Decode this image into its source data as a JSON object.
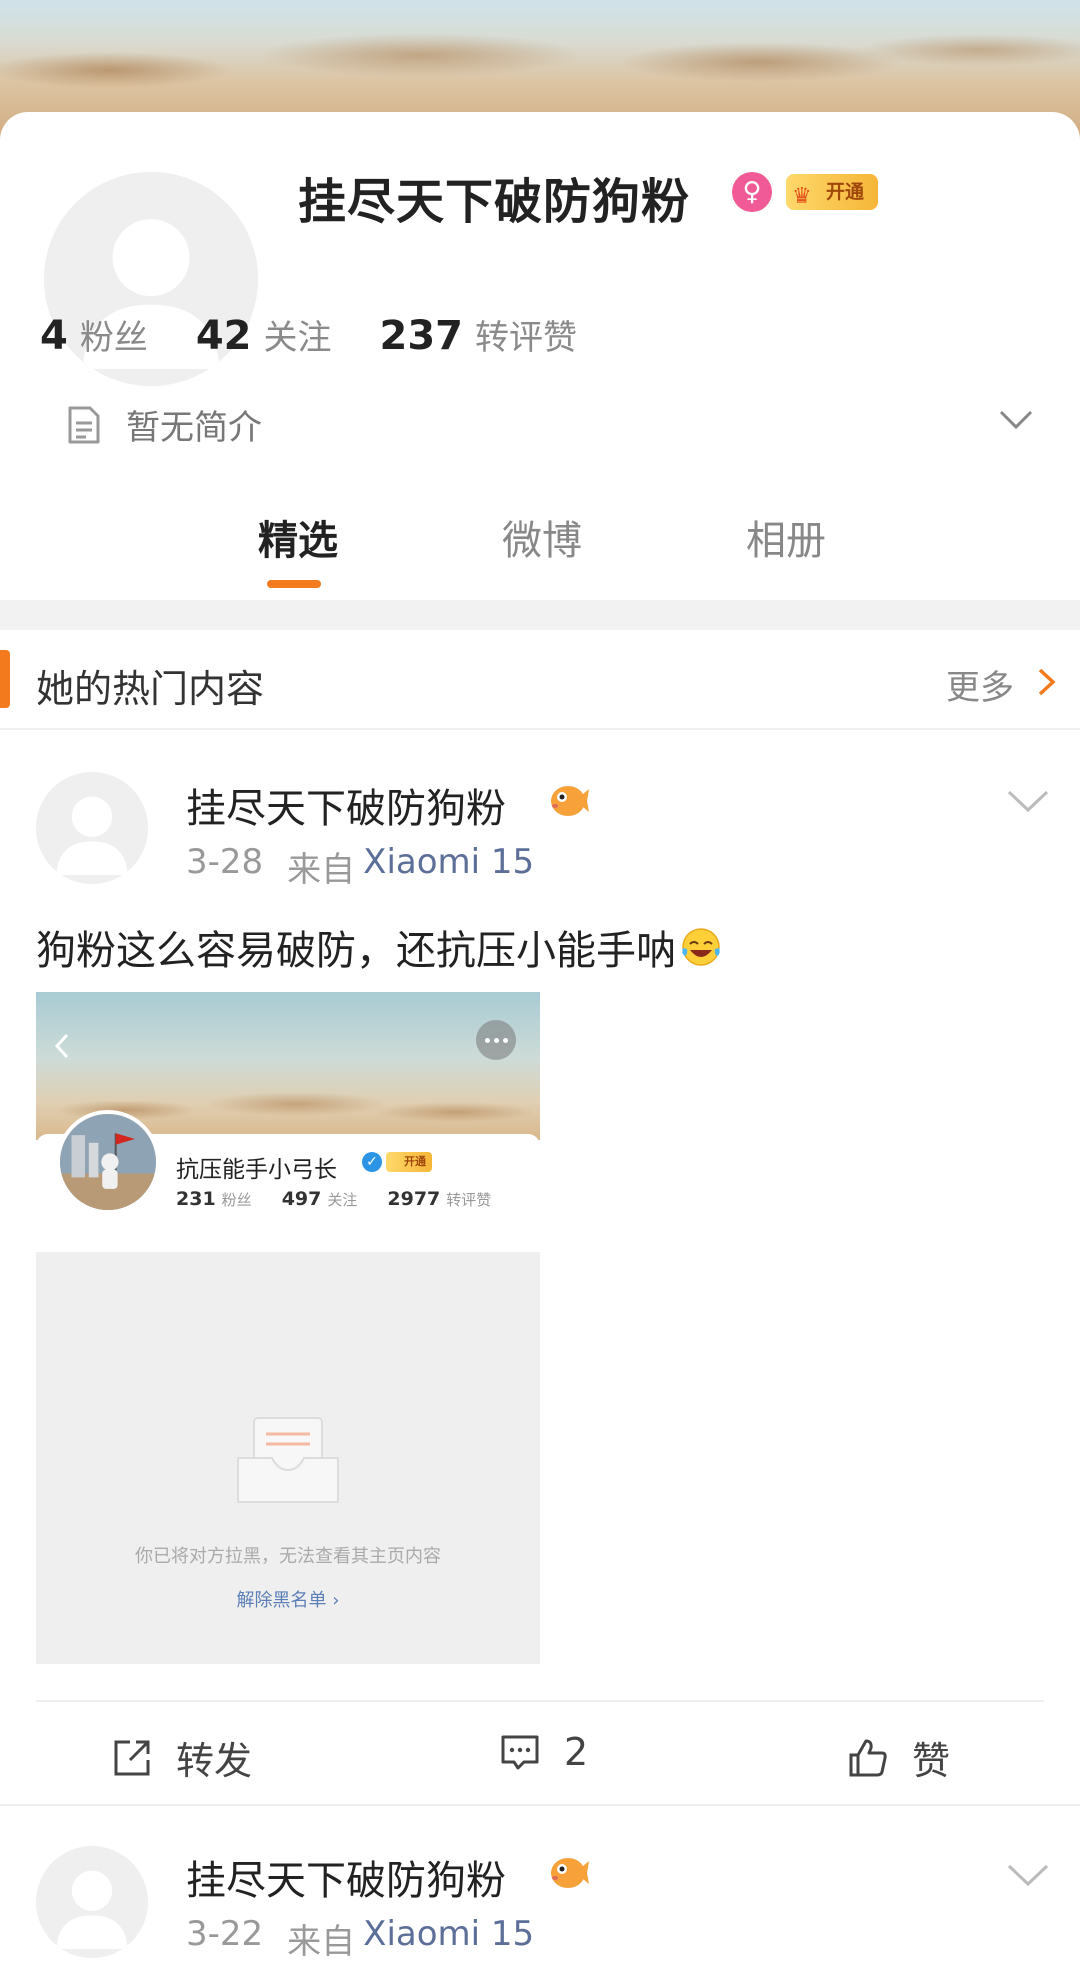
{
  "profile": {
    "username": "挂尽天下破防狗粉",
    "gender_symbol": "♀",
    "vip_badge": "开通",
    "stats": [
      {
        "num": "4",
        "label": "粉丝"
      },
      {
        "num": "42",
        "label": "关注"
      },
      {
        "num": "237",
        "label": "转评赞"
      }
    ],
    "bio": "暂无简介"
  },
  "tabs": [
    {
      "label": "精选",
      "active": true
    },
    {
      "label": "微博",
      "active": false
    },
    {
      "label": "相册",
      "active": false
    }
  ],
  "hot_section": {
    "title": "她的热门内容",
    "more": "更多"
  },
  "posts": [
    {
      "author": "挂尽天下破防狗粉",
      "time": "3-28",
      "source_prefix": "来自",
      "device": "Xiaomi 15",
      "text": "狗粉这么容易破防，还抗压小能手呐",
      "embed": {
        "name": "抗压能手小弓长",
        "vip": "开通",
        "stats": [
          {
            "num": "231",
            "label": "粉丝"
          },
          {
            "num": "497",
            "label": "关注"
          },
          {
            "num": "2977",
            "label": "转评赞"
          }
        ],
        "empty_text": "你已将对方拉黑，无法查看其主页内容",
        "unblock": "解除黑名单 ›"
      },
      "actions": {
        "repost": "转发",
        "comment": "2",
        "like": "赞"
      }
    },
    {
      "author": "挂尽天下破防狗粉",
      "time": "3-22",
      "source_prefix": "来自",
      "device": "Xiaomi 15"
    }
  ],
  "colors": {
    "accent": "#f37b1d",
    "female_badge": "#f05a96",
    "device_link": "#5c6f98"
  }
}
